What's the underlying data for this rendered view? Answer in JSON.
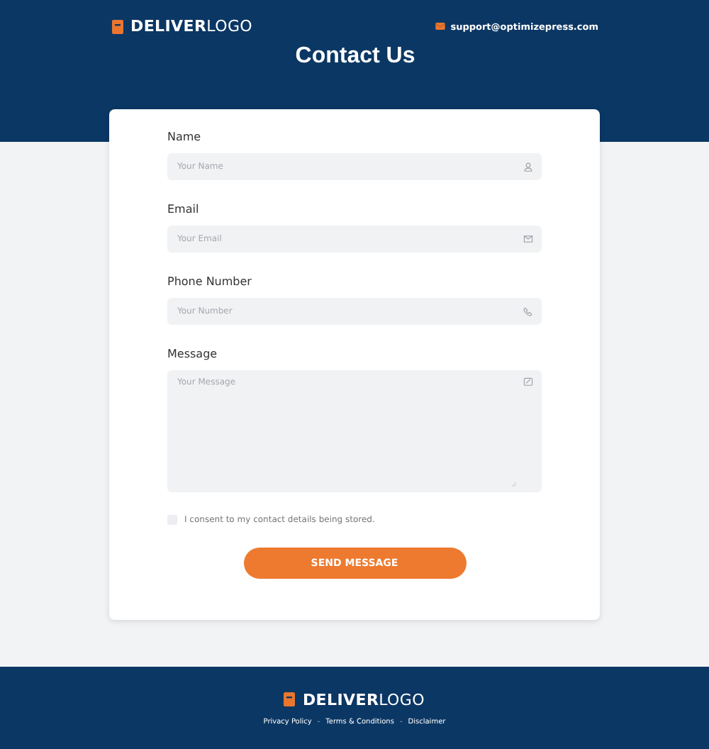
{
  "header": {
    "logo": "**DELIVER**LOGO",
    "email": "support@optimizepress.com",
    "title": "Contact Us"
  },
  "form": {
    "fields": [
      {
        "label": "Name",
        "placeholder": "Your Name",
        "kind": "person"
      },
      {
        "label": "Email",
        "placeholder": "Your Email",
        "kind": "email"
      },
      {
        "label": "Phone Number",
        "placeholder": "Your Number",
        "kind": "phone"
      },
      {
        "label": "Message",
        "placeholder": "Your Message",
        "kind": "message"
      }
    ],
    "consent": {
      "label": "I consent to my contact details being stored.",
      "checked": false
    },
    "submit": "SEND MESSAGE"
  },
  "footer": {
    "logo": "**DELIVER**LOGO",
    "items": [
      {
        "kind": "link",
        "text": "Privacy Policy"
      },
      {
        "kind": "separator",
        "text": "-"
      },
      {
        "kind": "link",
        "text": "Terms & Conditions"
      },
      {
        "kind": "separator",
        "text": "-"
      },
      {
        "kind": "link",
        "text": "Disclaimer"
      }
    ]
  }
}
